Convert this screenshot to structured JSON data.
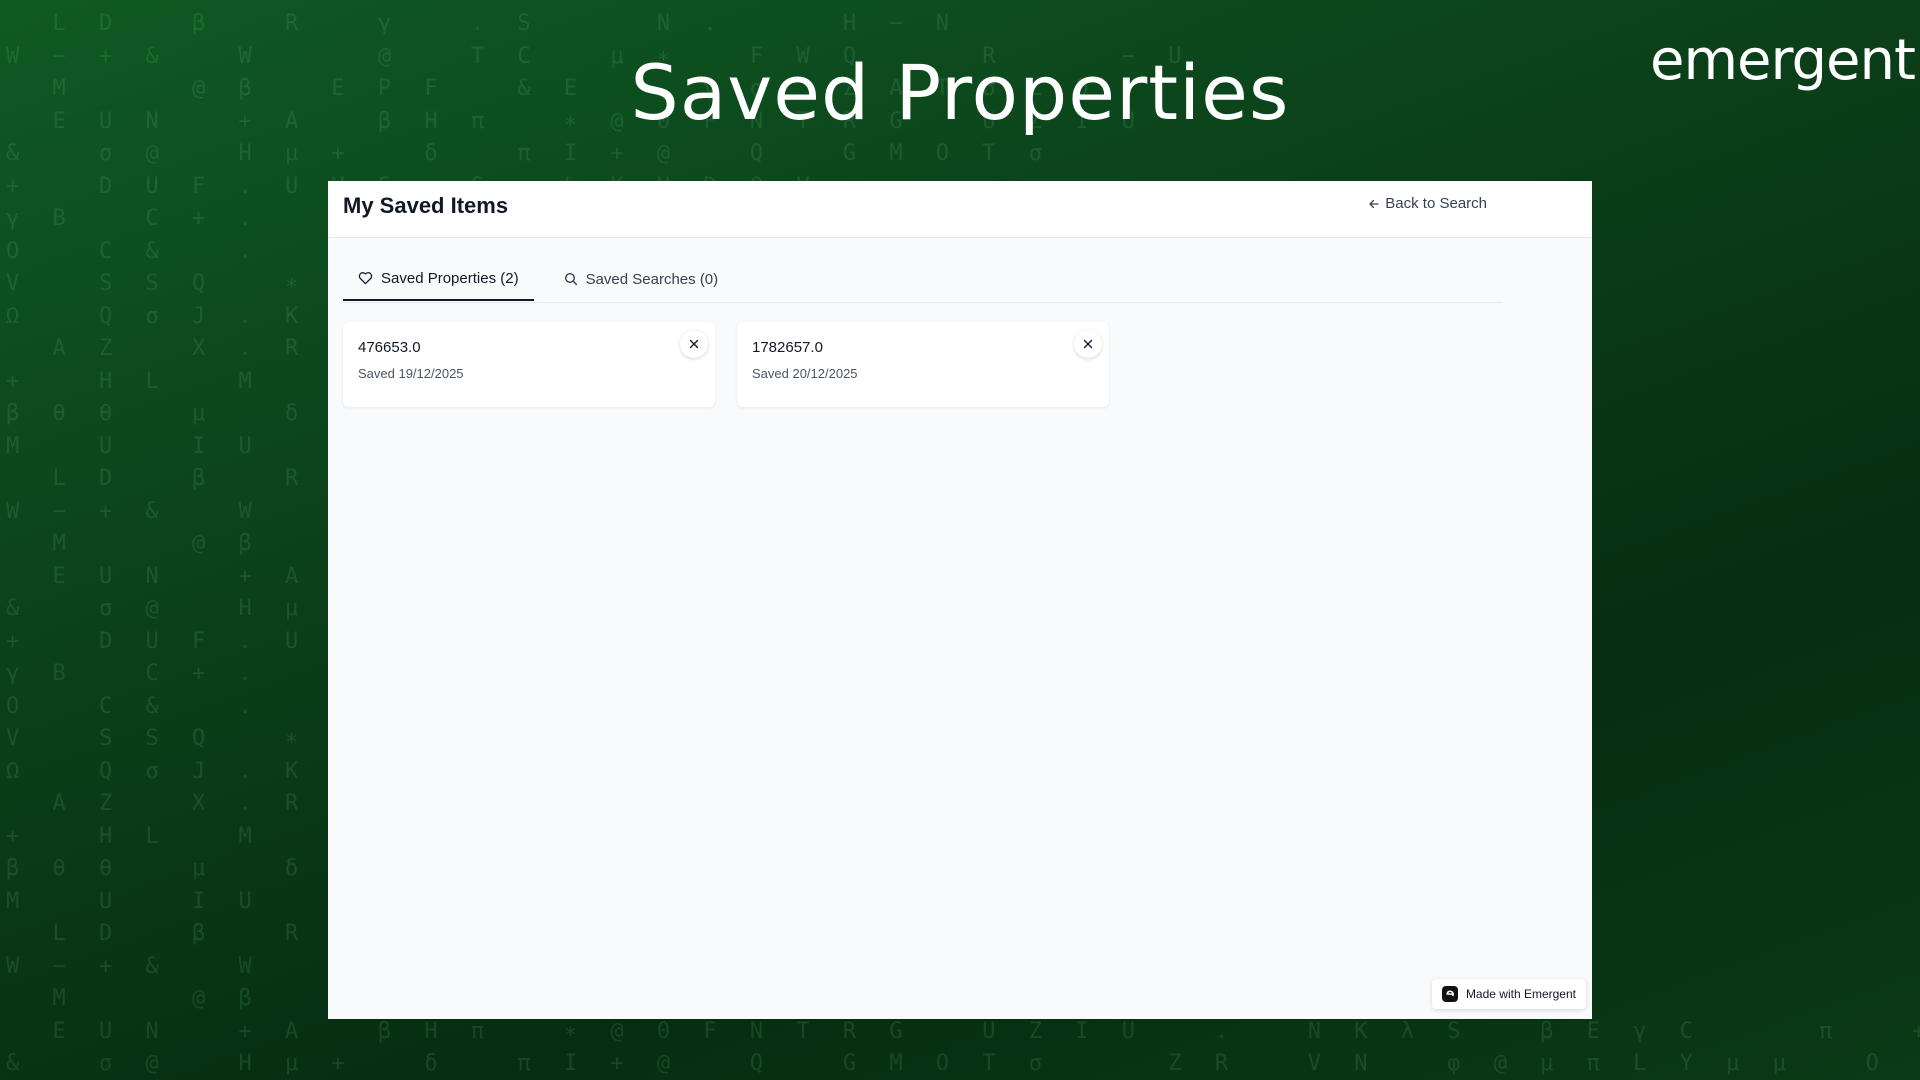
{
  "headline": "Saved Properties",
  "brand": "emergent",
  "app": {
    "title": "My Saved Items",
    "back_label": "Back to Search",
    "tabs": [
      {
        "label": "Saved Properties (2)",
        "icon": "heart-icon",
        "active": true
      },
      {
        "label": "Saved Searches (0)",
        "icon": "search-icon",
        "active": false
      }
    ],
    "cards": [
      {
        "id": "476653.0",
        "date": "Saved 19/12/2025"
      },
      {
        "id": "1782657.0",
        "date": "Saved 20/12/2025"
      }
    ],
    "made_with": "Made with Emergent"
  },
  "colors": {
    "background_green": "#0b3f19",
    "panel": "#f8fafc",
    "text_dark": "#111827"
  }
}
